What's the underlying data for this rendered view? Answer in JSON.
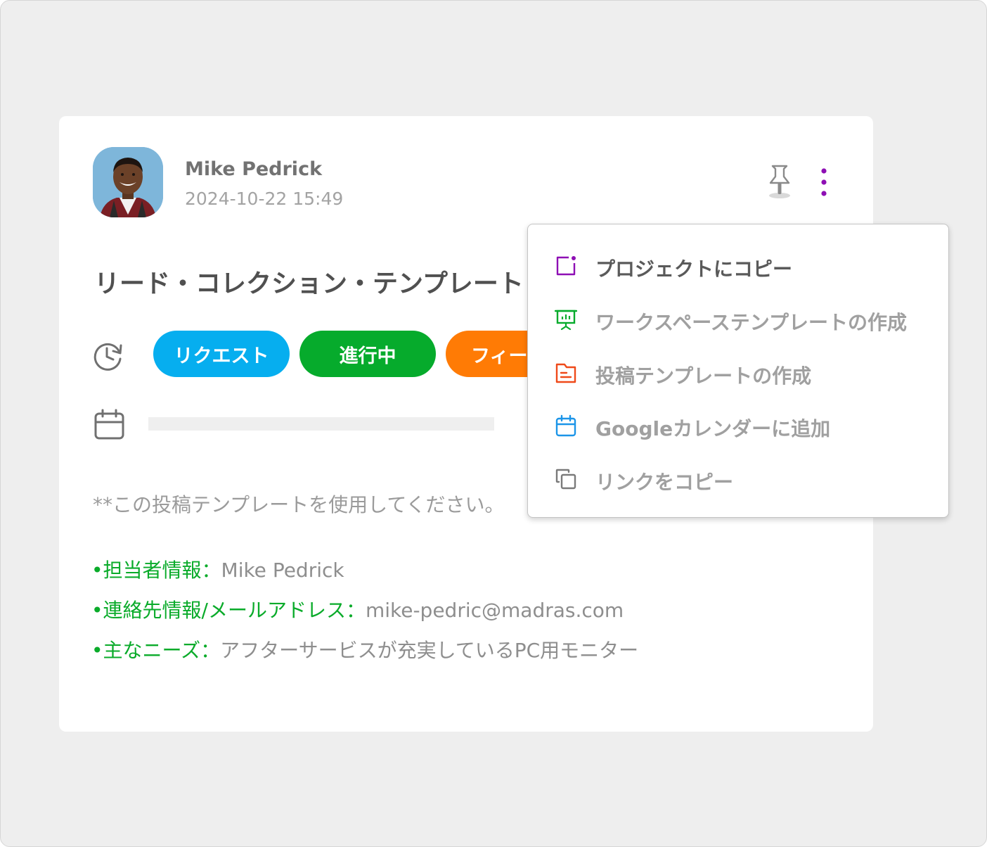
{
  "post": {
    "author": "Mike Pedrick",
    "timestamp": "2024-10-22 15:49",
    "title": "リード・コレクション・テンプレート",
    "tags": [
      {
        "label": "リクエスト",
        "color": "#06aeef"
      },
      {
        "label": "進行中",
        "color": "#06ab2c"
      },
      {
        "label": "フィー",
        "color": "#ff7b05"
      }
    ],
    "note": "**この投稿テンプレートを使用してください。",
    "fields": [
      {
        "label": "担当者情報：",
        "value": "Mike Pedrick"
      },
      {
        "label": "連絡先情報/メールアドレス：",
        "value": "mike-pedric@madras.com"
      },
      {
        "label": "主なニーズ：",
        "value": "アフターサービスが充実しているPC用モニター"
      }
    ],
    "bullet": "•"
  },
  "icons": {
    "pin": "pin-icon",
    "more": "more-vertical-icon",
    "status": "history-icon",
    "date": "calendar-icon"
  },
  "menu": {
    "items": [
      {
        "label": "プロジェクトにコピー",
        "icon": "project-copy-icon",
        "icon_color": "#8e0fb4"
      },
      {
        "label": "ワークスペーステンプレートの作成",
        "icon": "presentation-board-icon",
        "icon_color": "#06ab2c"
      },
      {
        "label": "投稿テンプレートの作成",
        "icon": "folder-document-icon",
        "icon_color": "#ef4a1a"
      },
      {
        "label": "Googleカレンダーに追加",
        "icon": "calendar-icon",
        "icon_color": "#1c95e8"
      },
      {
        "label": "リンクをコピー",
        "icon": "copy-icon",
        "icon_color": "#7a7a7a"
      }
    ]
  },
  "colors": {
    "accent_menu": "#8e0fb4",
    "field_label": "#0aab2a"
  }
}
